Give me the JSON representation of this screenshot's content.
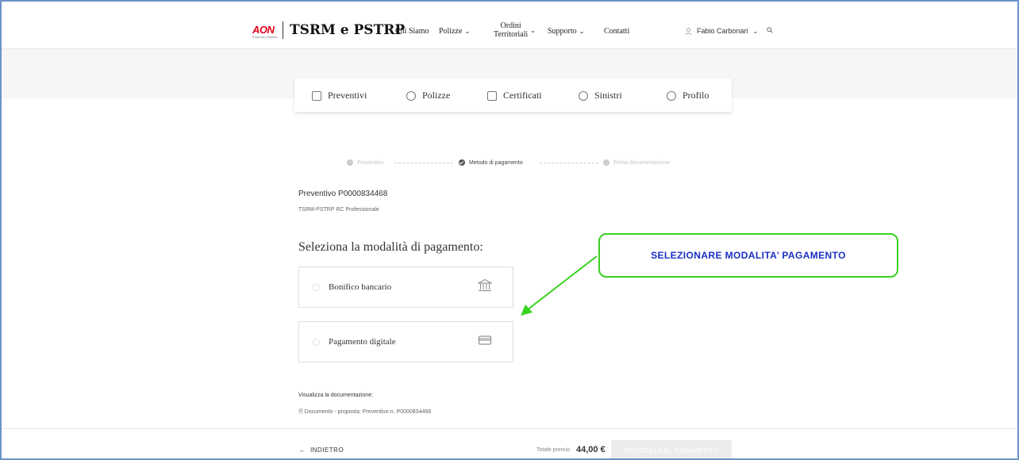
{
  "header": {
    "logo_text": "AON",
    "logo_tagline": "Empower Results",
    "brand": "TSRM e PSTRP",
    "nav": [
      {
        "label": "Chi Siamo"
      },
      {
        "label": "Polizze"
      },
      {
        "label_line1": "Ordini",
        "label_line2": "Territoriali"
      },
      {
        "label": "Supporto"
      },
      {
        "label": "Contatti"
      }
    ],
    "user_name": "Fabio Carbonari"
  },
  "tabs": [
    {
      "label": "Preventivi",
      "icon": "quote-icon"
    },
    {
      "label": "Polizze",
      "icon": "shield-icon"
    },
    {
      "label": "Certificati",
      "icon": "certificate-icon"
    },
    {
      "label": "Sinistri",
      "icon": "claim-icon"
    },
    {
      "label": "Profilo",
      "icon": "user-icon"
    }
  ],
  "stepper": {
    "steps": [
      "Preventivo",
      "Metodo di pagamento",
      "Firma documentazione"
    ],
    "current_index": 1
  },
  "quote": {
    "title": "Preventivo P0000834468",
    "subtitle": "TSRM-PSTRP RC Professionale"
  },
  "payment": {
    "section_title": "Seleziona la modalità di pagamento:",
    "options": [
      {
        "label": "Bonifico bancario",
        "icon": "bank-icon"
      },
      {
        "label": "Pagamento digitale",
        "icon": "card-icon"
      }
    ]
  },
  "docs": {
    "title": "Visualizza la documentazione:",
    "link": "Documento - proposta: Preventivo n. P0000834468"
  },
  "footer": {
    "back_label": "INDIETRO",
    "total_label": "Totale premio",
    "total_value": "44,00 €",
    "proceed_label": "PROSEGUI AL PAGAMENTO"
  },
  "annotation": {
    "text": "SELEZIONARE MODALITA’ PAGAMENTO",
    "color_border": "#39d11f",
    "color_text": "#1a2ec8"
  }
}
